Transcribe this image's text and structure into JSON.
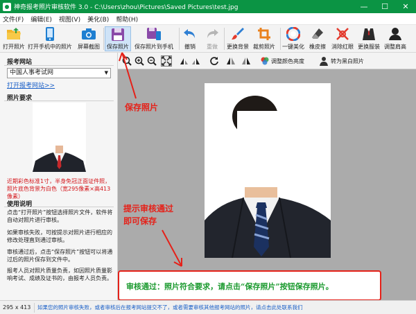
{
  "window": {
    "title": "神奇报考照片审核软件 3.0 - C:\\Users\\zhou\\Pictures\\Saved Pictures\\test.jpg",
    "minimize": "—",
    "maximize": "☐",
    "close": "✕"
  },
  "menu": [
    "文件(F)",
    "编辑(E)",
    "视图(V)",
    "美化(B)",
    "帮助(H)"
  ],
  "toolbar": {
    "open_photo": "打开照片",
    "open_phone_photo": "打开手机中的照片",
    "screenshot": "屏幕截图",
    "save_photo": "保存照片",
    "save_to_phone": "保存照片到手机",
    "undo": "撤销",
    "redo": "重做",
    "change_bg": "更换背景",
    "crop": "裁剪照片",
    "one_click_beautify": "一键美化",
    "eraser": "橡皮擦",
    "red_eye": "消除红眼",
    "change_clothes": "更换服装",
    "adjust_hair": "调整肩高"
  },
  "image_toolbar": {
    "adjust_color": "调整颜色亮度",
    "to_grayscale": "转为黑白照片"
  },
  "sidebar": {
    "site_title": "报考网站",
    "site_selected": "中国人事考试网",
    "open_site_link": "打开报考网站>>",
    "req_title": "照片要求",
    "req_text": "近期彩色标准1寸，半身免冠正面证件照，照片底色背景为白色（宽295像素×高413像素）",
    "usage_title": "使用说明",
    "usage_1": "点击“打开照片”按钮选择照片文件，软件将自动对照片进行审核。",
    "usage_2": "如果审核失败，可按提示对照片进行相应的修改处理直到通过审核。",
    "usage_3": "审核通过后，点击“保存照片”按钮可以将通过后的照片保存到文件中。",
    "usage_4": "报考人员对照片质量负责，如因照片质量影响考试、成绩及证书的，由报考人员负责。"
  },
  "annotations": {
    "save_hint": "保存照片",
    "pass_hint_1": "提示审核通过",
    "pass_hint_2": "即可保存"
  },
  "result": {
    "message": "审核通过：照片符合要求，请点击“保存照片”按钮保存照片。"
  },
  "status": {
    "size": "295 x 413",
    "message": "如果您的照片审核失败，或者审核后在报考网站提交不了，或者需要审核其他报考网站的照片，请点击此处联系我们"
  },
  "colors": {
    "title_bar": "#0b9444",
    "annotation_red": "#e52119",
    "pass_green": "#1b9a2f",
    "link_blue": "#1a5fc7"
  }
}
